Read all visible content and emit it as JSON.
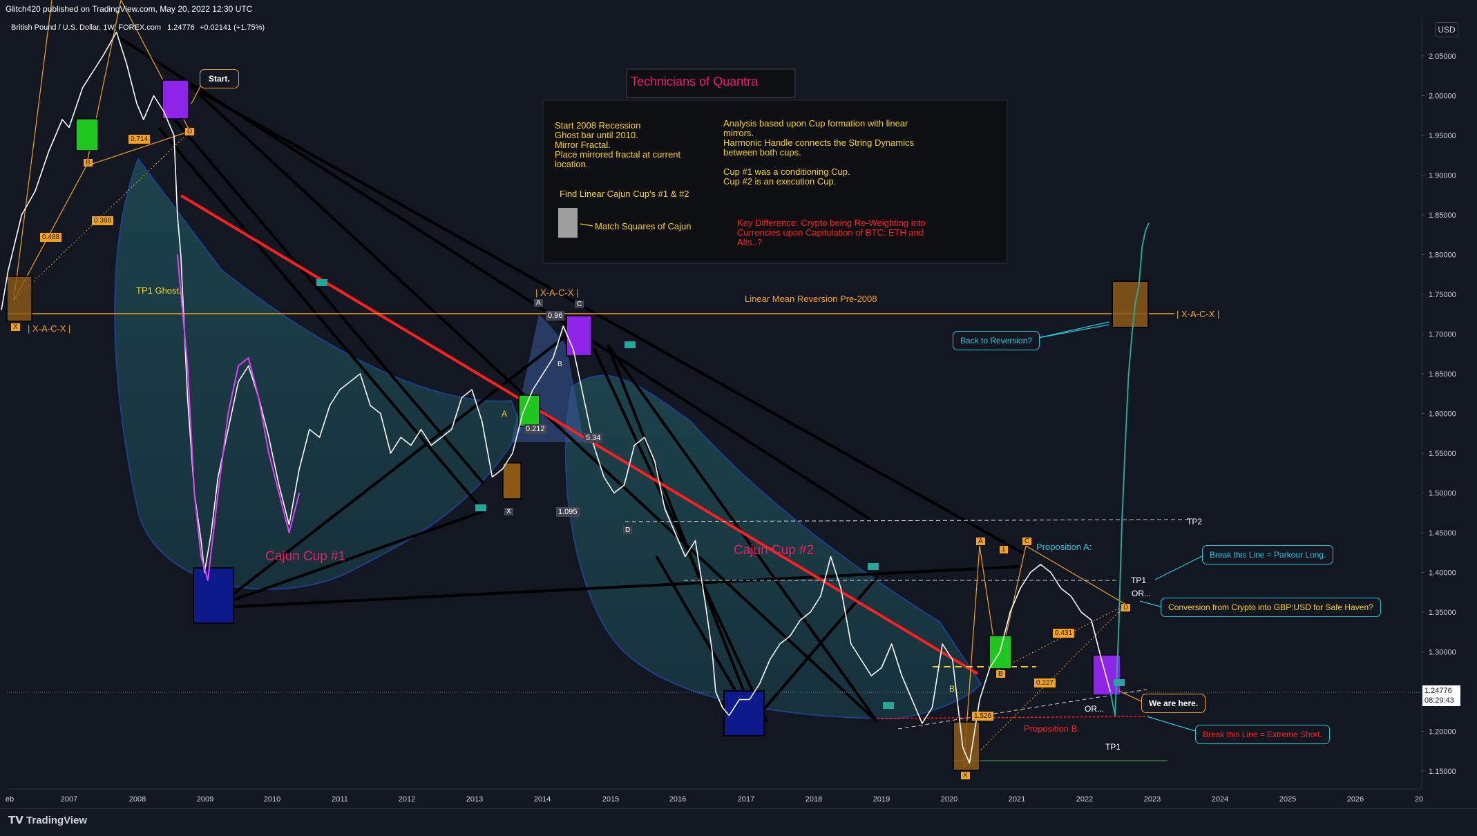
{
  "header": {
    "published_by": "Glitch420 published on TradingView.com, May 20, 2022 12:30 UTC",
    "symbol_line": "British Pound / U.S. Dollar, 1W, FOREX.com",
    "price": "1.24776",
    "change": "+0.02141 (+1.75%)"
  },
  "toolbar": {
    "currency_label": "USD"
  },
  "footer": {
    "brand": "TradingView"
  },
  "price_tag": {
    "value": "1.24776",
    "time": "08:29:43"
  },
  "colors": {
    "background": "#131722",
    "price_line": "#ffffff",
    "ghost_line": "#e040fb",
    "cup_fill": "#1a3a44",
    "red_line": "#ff1f1f",
    "orange": "#f7a21b",
    "teal_line": "#26a69a",
    "callout_cyan": "#26c6da",
    "title_pink": "#e91e63"
  },
  "chart_data": {
    "type": "line",
    "xlabel": "",
    "ylabel": "",
    "x_ticks": [
      "eb",
      "2007",
      "2008",
      "2009",
      "2010",
      "2011",
      "2012",
      "2013",
      "2014",
      "2015",
      "2016",
      "2017",
      "2018",
      "2019",
      "2020",
      "2021",
      "2022",
      "2023",
      "2024",
      "2025",
      "2026",
      "20"
    ],
    "y_ticks": [
      "2.05000",
      "2.00000",
      "1.95000",
      "1.90000",
      "1.85000",
      "1.80000",
      "1.75000",
      "1.70000",
      "1.65000",
      "1.60000",
      "1.55000",
      "1.50000",
      "1.45000",
      "1.40000",
      "1.35000",
      "1.30000",
      "1.25000",
      "1.20000",
      "1.15000"
    ],
    "ylim": [
      1.13,
      2.09
    ],
    "xlim": [
      2006.0,
      2027.3
    ],
    "series": [
      {
        "x": [
          2006.0,
          2006.1,
          2006.3,
          2006.5,
          2006.7,
          2006.9,
          2007.0,
          2007.2,
          2007.35,
          2007.5,
          2007.7,
          2007.85,
          2008.0,
          2008.1,
          2008.25,
          2008.4,
          2008.55,
          2008.6,
          2008.65,
          2008.75,
          2008.85,
          2008.95,
          2009.0,
          2009.1,
          2009.2,
          2009.35,
          2009.5,
          2009.65,
          2009.8,
          2009.95,
          2010.1,
          2010.25,
          2010.4,
          2010.55,
          2010.7,
          2010.85,
          2011.0,
          2011.15,
          2011.3,
          2011.45,
          2011.6,
          2011.75,
          2011.9,
          2012.05,
          2012.2,
          2012.35,
          2012.5,
          2012.65,
          2012.8,
          2012.95,
          2013.1,
          2013.25,
          2013.4,
          2013.55,
          2013.7,
          2013.85,
          2014.0,
          2014.15,
          2014.3,
          2014.45,
          2014.6,
          2014.75,
          2014.9,
          2015.05,
          2015.2,
          2015.35,
          2015.5,
          2015.65,
          2015.8,
          2015.95,
          2016.1,
          2016.25,
          2016.4,
          2016.5,
          2016.55,
          2016.65,
          2016.75,
          2016.9,
          2017.05,
          2017.2,
          2017.35,
          2017.5,
          2017.65,
          2017.8,
          2017.95,
          2018.1,
          2018.25,
          2018.4,
          2018.55,
          2018.7,
          2018.85,
          2019.0,
          2019.15,
          2019.3,
          2019.45,
          2019.6,
          2019.75,
          2019.9,
          2020.05,
          2020.2,
          2020.3,
          2020.45,
          2020.6,
          2020.75,
          2020.9,
          2021.05,
          2021.2,
          2021.35,
          2021.5,
          2021.65,
          2021.8,
          2021.95,
          2022.1,
          2022.25,
          2022.38
        ],
        "y": [
          1.73,
          1.78,
          1.85,
          1.88,
          1.93,
          1.97,
          1.96,
          2.01,
          2.03,
          2.05,
          2.08,
          2.04,
          1.99,
          1.97,
          2.0,
          1.98,
          1.95,
          1.85,
          1.8,
          1.62,
          1.5,
          1.44,
          1.4,
          1.45,
          1.52,
          1.58,
          1.64,
          1.66,
          1.62,
          1.57,
          1.51,
          1.46,
          1.53,
          1.58,
          1.57,
          1.61,
          1.63,
          1.64,
          1.65,
          1.61,
          1.6,
          1.55,
          1.57,
          1.56,
          1.58,
          1.56,
          1.57,
          1.58,
          1.62,
          1.63,
          1.59,
          1.52,
          1.53,
          1.55,
          1.6,
          1.63,
          1.65,
          1.67,
          1.71,
          1.68,
          1.62,
          1.56,
          1.52,
          1.5,
          1.51,
          1.56,
          1.57,
          1.54,
          1.48,
          1.45,
          1.42,
          1.44,
          1.36,
          1.3,
          1.25,
          1.23,
          1.22,
          1.24,
          1.24,
          1.26,
          1.29,
          1.31,
          1.32,
          1.34,
          1.35,
          1.37,
          1.42,
          1.38,
          1.31,
          1.29,
          1.27,
          1.28,
          1.31,
          1.27,
          1.24,
          1.21,
          1.23,
          1.31,
          1.29,
          1.18,
          1.16,
          1.24,
          1.28,
          1.3,
          1.35,
          1.38,
          1.4,
          1.41,
          1.4,
          1.38,
          1.37,
          1.35,
          1.34,
          1.29,
          1.25
        ]
      },
      {
        "name": "ghost",
        "x": [
          2008.6,
          2008.75,
          2008.85,
          2008.95,
          2009.05,
          2009.2,
          2009.35,
          2009.5,
          2009.65,
          2009.8,
          2009.95,
          2010.1,
          2010.25,
          2010.4
        ],
        "y": [
          1.8,
          1.66,
          1.5,
          1.42,
          1.39,
          1.5,
          1.6,
          1.66,
          1.67,
          1.62,
          1.55,
          1.5,
          1.45,
          1.5
        ]
      },
      {
        "name": "projection",
        "x": [
          2022.38,
          2022.45,
          2022.5,
          2022.55,
          2022.6,
          2022.65,
          2022.7,
          2022.75,
          2022.8,
          2022.85,
          2022.9,
          2022.95
        ],
        "y": [
          1.25,
          1.22,
          1.32,
          1.46,
          1.56,
          1.65,
          1.7,
          1.74,
          1.76,
          1.81,
          1.83,
          1.84
        ]
      }
    ],
    "levels": [
      {
        "label": "Linear Mean Reversion Pre-2008",
        "y": 1.725
      },
      {
        "label": "TP2",
        "y": 1.462
      },
      {
        "label": "TP1",
        "y": 1.388
      },
      {
        "label": "TP1",
        "y": 1.16
      }
    ],
    "annotations": {
      "title": "Technicians of Quantra",
      "notes_left": [
        "Start 2008 Recession",
        "Ghost bar until 2010.",
        "Mirror Fractal.",
        "Place mirrored fractal at current",
        "location."
      ],
      "notes_right": [
        "Analysis based upon Cup formation with linear",
        "mirrors.",
        "Harmonic Handle connects the String Dynamics",
        "between both cups.",
        "",
        "Cup #1 was a conditioning Cup.",
        "Cup #2 is an execution Cup."
      ],
      "find_cups": "Find Linear Cajun Cup's #1 & #2",
      "match_squares": "Match Squares of Cajun",
      "key_difference": [
        "Key Difference: Crypto being  Re-Weighting into",
        "Currencies upon Capitulation of BTC: ETH and",
        "Alts..?"
      ],
      "cup1": "Cajun Cup #1",
      "cup2": "Cajun Cup #2",
      "tp1_ghost": "TP1 Ghost.",
      "xacx_left": "| X-A-C-X |",
      "xacx_mid": "| X-A-C-X |",
      "xacx_right": "| X-A-C-X |",
      "proposition_a": "Proposition A:",
      "proposition_b": "Proposition B.",
      "or1": "OR...",
      "or2": "OR...",
      "callout_start": "Start.",
      "callout_back": "Back to Reversion?",
      "callout_parkour": "Break this Line = Parkour Long.",
      "callout_conversion": "Conversion from Crypto into GBP:USD for Safe Haven?",
      "callout_here": "We are here.",
      "callout_extreme": "Break this Line = Extreme Short.",
      "fib_0714": "0.714",
      "fib_0488": "0.488",
      "fib_0388": "0.388",
      "fib_096": "0.96",
      "fib_0212": "0.212",
      "fib_534": "5.34",
      "fib_1095": "1.095",
      "fib_0431": "0.431",
      "fib_0227": "0.227",
      "fib_1526": "1.526",
      "pt_A": "A",
      "pt_B": "B",
      "pt_C": "C",
      "pt_D": "D",
      "pt_X": "X",
      "pt_1": "1"
    }
  }
}
